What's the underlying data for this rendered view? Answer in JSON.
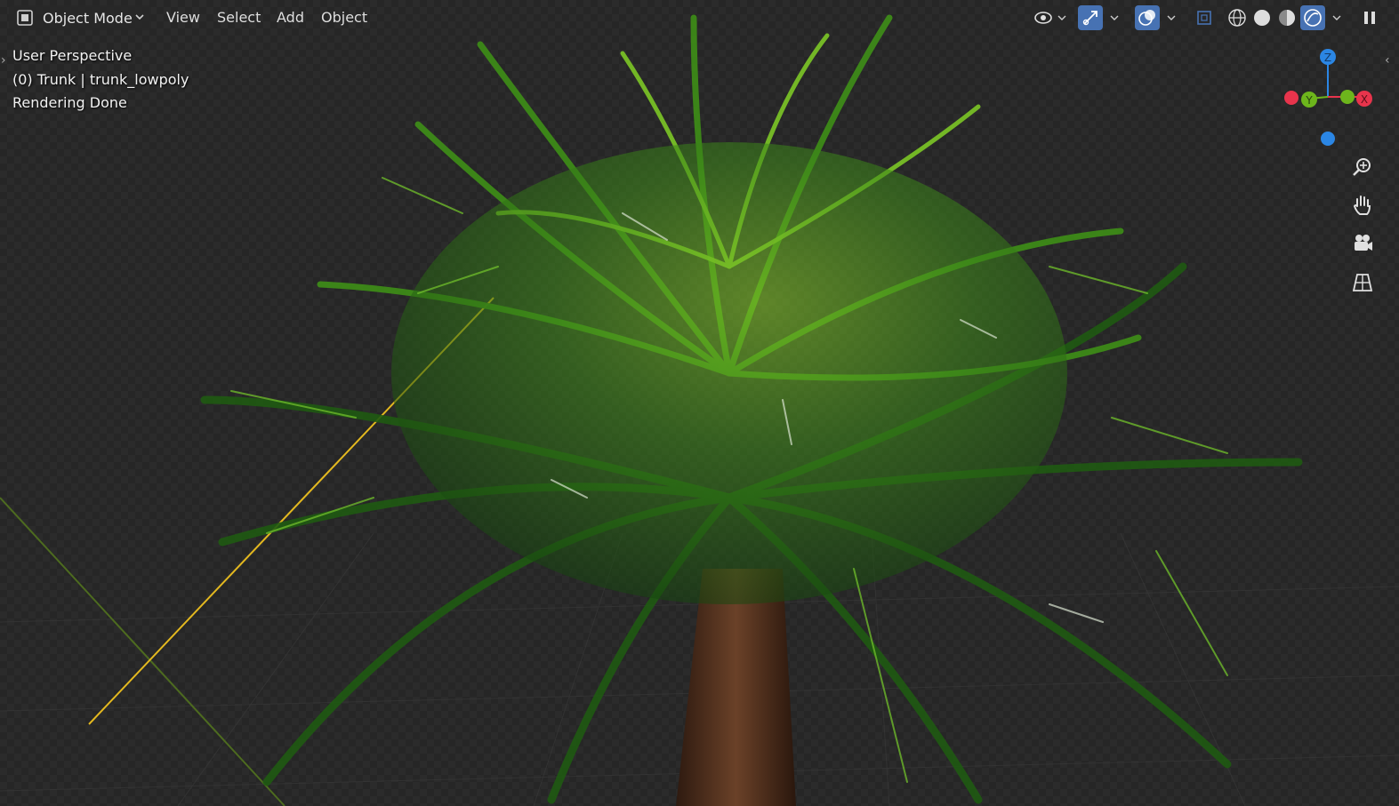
{
  "header": {
    "mode_label": "Object Mode",
    "menus": [
      "View",
      "Select",
      "Add",
      "Object"
    ]
  },
  "overlay_info": {
    "view_name": "User Perspective",
    "active_object": "(0) Trunk | trunk_lowpoly",
    "status": "Rendering Done"
  },
  "gizmo": {
    "z_label": "Z",
    "y_label": "Y",
    "x_label": "X",
    "colors": {
      "x": "#e8344c",
      "y": "#6db51c",
      "z": "#2b86e4"
    }
  },
  "icons": {
    "mode": "object-mode-icon",
    "visibility": "eye-visibility-icon",
    "gizmo_toggle": "gizmo-toggle-icon",
    "overlays": "overlays-icon",
    "xray": "xray-icon",
    "wireframe": "wireframe-shading-icon",
    "solid": "solid-shading-icon",
    "material": "material-preview-icon",
    "rendered": "rendered-shading-icon",
    "pause": "pause-icon",
    "zoom": "zoom-icon",
    "pan": "pan-hand-icon",
    "camera": "camera-view-icon",
    "ortho": "perspective-ortho-icon"
  },
  "colors": {
    "accent": "#4772b3",
    "foliage": "#4a8c1c",
    "trunk": "#5a3a24",
    "light_line": "#e3b81f"
  }
}
